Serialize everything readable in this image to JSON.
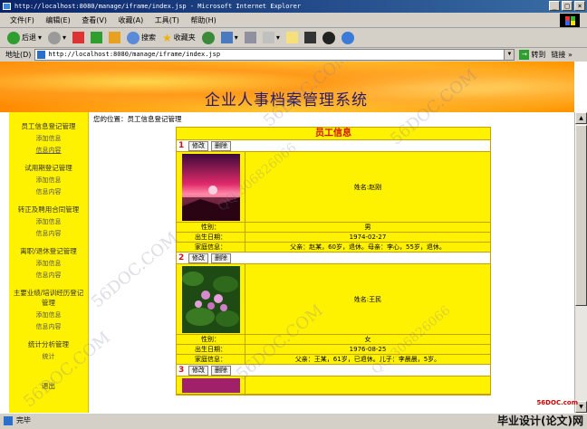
{
  "window": {
    "title": "http://localhost:8080/manage/iframe/index.jsp - Microsoft Internet Explorer"
  },
  "menu": [
    "文件(F)",
    "编辑(E)",
    "查看(V)",
    "收藏(A)",
    "工具(T)",
    "帮助(H)"
  ],
  "toolbar": {
    "back": "后退",
    "search": "搜索",
    "favorites": "收藏夹"
  },
  "address": {
    "label": "地址(D)",
    "url": "http://localhost:8080/manage/iframe/index.jsp",
    "go": "转到",
    "links": "链接 »"
  },
  "page": {
    "title": "企业人事档案管理系统",
    "breadcrumb": "您的位置：员工信息登记管理",
    "panel_title": "员工信息"
  },
  "sidebar": [
    {
      "group": "员工信息登记管理",
      "items": [
        "添加信息",
        "信息内容"
      ]
    },
    {
      "group": "试用期登记管理",
      "items": [
        "添加信息",
        "信息内容"
      ]
    },
    {
      "group": "转正及聘用合同管理",
      "items": [
        "添加信息",
        "信息内容"
      ]
    },
    {
      "group": "离职/退休登记管理",
      "items": [
        "添加信息",
        "信息内容"
      ]
    },
    {
      "group": "主要业绩/培训经历登记管理",
      "items": [
        "添加信息",
        "信息内容"
      ]
    },
    {
      "group": "统计分析管理",
      "items": [
        "统计"
      ]
    },
    {
      "group": "退出",
      "items": []
    }
  ],
  "buttons": {
    "edit": "修改",
    "delete": "删除"
  },
  "labels": {
    "gender": "性别：",
    "birth": "出生日期：",
    "family": "家庭信息："
  },
  "records": [
    {
      "num": "1",
      "name": "姓名:赵刚",
      "gender": "男",
      "birth": "1974-02-27",
      "family": "父亲：赵某，60岁，退休。母亲：李心，55岁，退休。"
    },
    {
      "num": "2",
      "name": "姓名:王民",
      "gender": "女",
      "birth": "1976-08-25",
      "family": "父亲：王某，61岁，已退休。儿子：李晨晨，5岁。"
    },
    {
      "num": "3"
    }
  ],
  "status": {
    "text": "完毕"
  },
  "branding": {
    "text": "毕业设计(论文)网",
    "site": "56DOC.com",
    "watermark": "56DOC.COM",
    "qq": "QQ:306826066"
  }
}
